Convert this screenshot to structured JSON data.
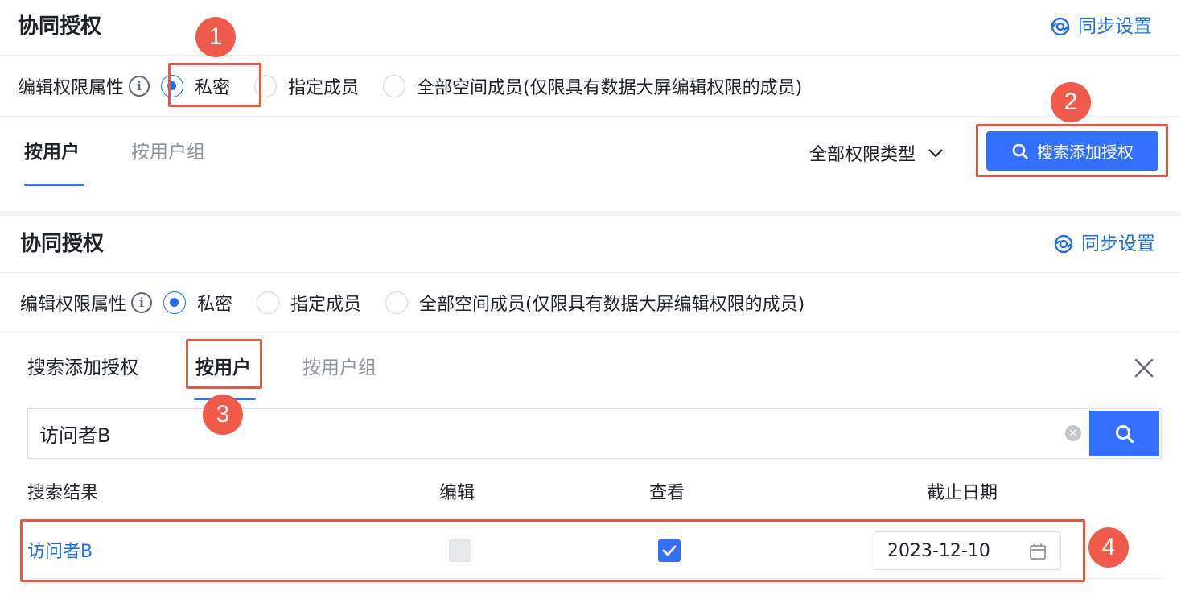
{
  "top_panel": {
    "title": "协同授权",
    "sync_label": "同步设置",
    "edit_permission_label": "编辑权限属性",
    "radio_options": [
      "私密",
      "指定成员",
      "全部空间成员(仅限具有数据大屏编辑权限的成员)"
    ],
    "selected_radio": 0,
    "tabs": [
      "按用户",
      "按用户组"
    ],
    "active_tab": 0,
    "type_filter": "全部权限类型",
    "search_add_button": "搜索添加授权"
  },
  "bottom_panel": {
    "title": "协同授权",
    "sync_label": "同步设置",
    "edit_permission_label": "编辑权限属性",
    "radio_options": [
      "私密",
      "指定成员",
      "全部空间成员(仅限具有数据大屏编辑权限的成员)"
    ],
    "selected_radio": 0,
    "dialog_title": "搜索添加授权",
    "tabs": [
      "按用户",
      "按用户组"
    ],
    "active_tab": 0,
    "search_value": "访问者B",
    "columns": [
      "搜索结果",
      "编辑",
      "查看",
      "截止日期"
    ],
    "results": [
      {
        "name": "访问者B",
        "edit": false,
        "view": true,
        "deadline": "2023-12-10"
      }
    ]
  },
  "annotations": [
    "1",
    "2",
    "3",
    "4"
  ],
  "colors": {
    "accent": "#3370ff",
    "link": "#1f6fea",
    "highlight": "#e8574a",
    "badge": "#f05a4a"
  },
  "icons": {
    "sync": "sync-icon",
    "info": "info-icon",
    "search": "search-icon",
    "chevron": "chevron-down-icon",
    "close": "close-icon",
    "calendar": "calendar-icon",
    "check": "check-icon"
  }
}
